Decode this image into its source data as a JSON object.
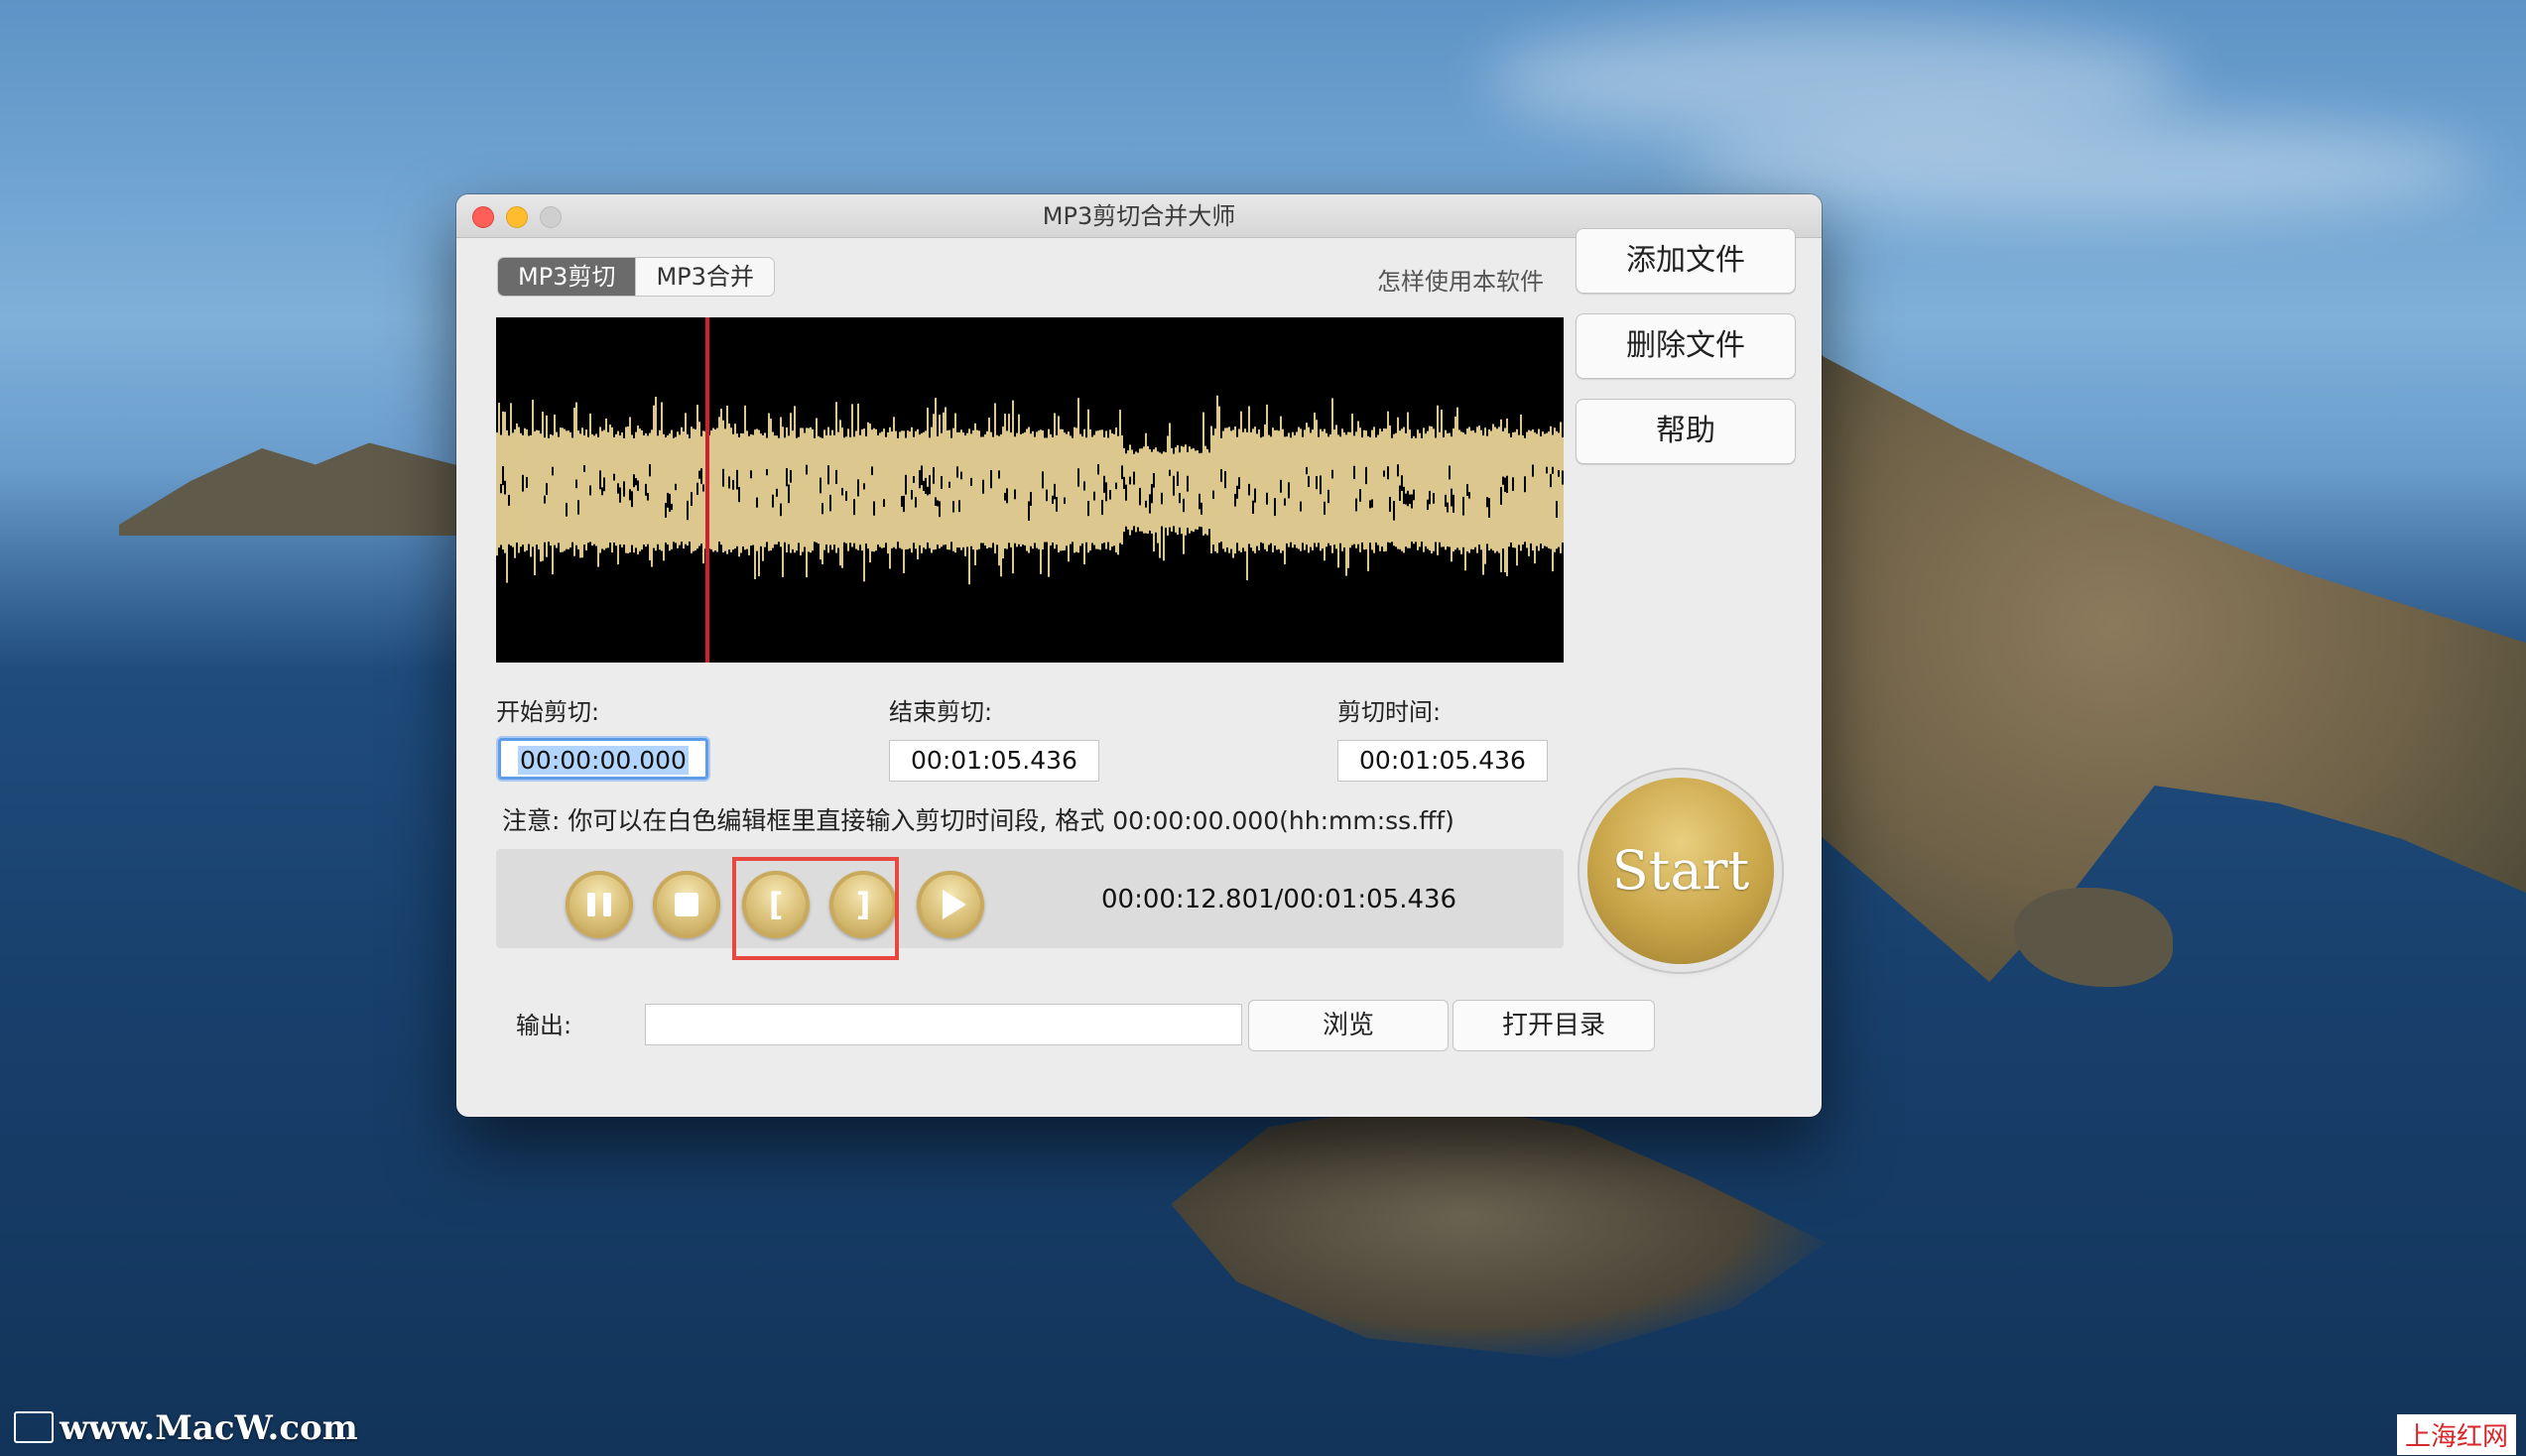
{
  "window": {
    "title": "MP3剪切合并大师"
  },
  "tabs": [
    {
      "label": "MP3剪切",
      "active": true
    },
    {
      "label": "MP3合并",
      "active": false
    }
  ],
  "help_link": "怎样使用本软件",
  "side_buttons": {
    "add_file": "添加文件",
    "delete_file": "删除文件",
    "help": "帮助"
  },
  "cut": {
    "start_label": "开始剪切:",
    "start_value": "00:00:00.000",
    "end_label": "结束剪切:",
    "end_value": "00:01:05.436",
    "duration_label": "剪切时间:",
    "duration_value": "00:01:05.436"
  },
  "note": "注意: 你可以在白色编辑框里直接输入剪切时间段, 格式 00:00:00.000(hh:mm:ss.fff)",
  "playback": {
    "time_display": "00:00:12.801/00:01:05.436",
    "playhead_fraction": 0.196,
    "mark_start_glyph": "[",
    "mark_end_glyph": "]"
  },
  "start_button": "Start",
  "output": {
    "label": "输出:",
    "value": "",
    "browse": "浏览",
    "open_dir": "打开目录"
  },
  "desktop": {
    "watermark": "www.MacW.com",
    "corner_brand": "上海红网"
  },
  "colors": {
    "waveform": "#dcc88e",
    "playhead": "#d0202a",
    "gold": "#c9a549",
    "highlight": "#e8473f"
  }
}
